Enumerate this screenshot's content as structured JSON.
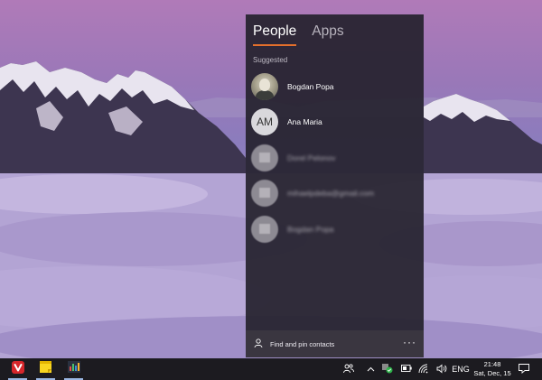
{
  "people_flyout": {
    "tabs": [
      {
        "label": "People",
        "active": true
      },
      {
        "label": "Apps",
        "active": false
      }
    ],
    "section_label": "Suggested",
    "contacts": [
      {
        "name": "Bogdan Popa",
        "avatar": "photo",
        "blurred": false
      },
      {
        "name": "Ana Maria",
        "avatar": "initials",
        "initials": "AM",
        "blurred": false
      },
      {
        "name": "Dorel Pelonov",
        "avatar": "blurred",
        "blurred": true
      },
      {
        "name": "mihaelpdeba@gmail.com",
        "avatar": "blurred",
        "blurred": true
      },
      {
        "name": "Bogdan Popa",
        "avatar": "blurred",
        "blurred": true
      }
    ],
    "footer": {
      "find_pin_label": "Find and pin contacts",
      "more_label": "···"
    },
    "accent_color": "#e36f2c"
  },
  "taskbar": {
    "pinned_apps": [
      {
        "name": "vivaldi-icon",
        "color": "#d6262b"
      },
      {
        "name": "sticky-notes-icon",
        "color": "#f8d520"
      },
      {
        "name": "task-manager-icon",
        "color": "#3a8fd6"
      }
    ],
    "tray": {
      "language": "ENG"
    },
    "clock": {
      "time": "21:48",
      "date": "Sat, Dec, 15"
    }
  }
}
